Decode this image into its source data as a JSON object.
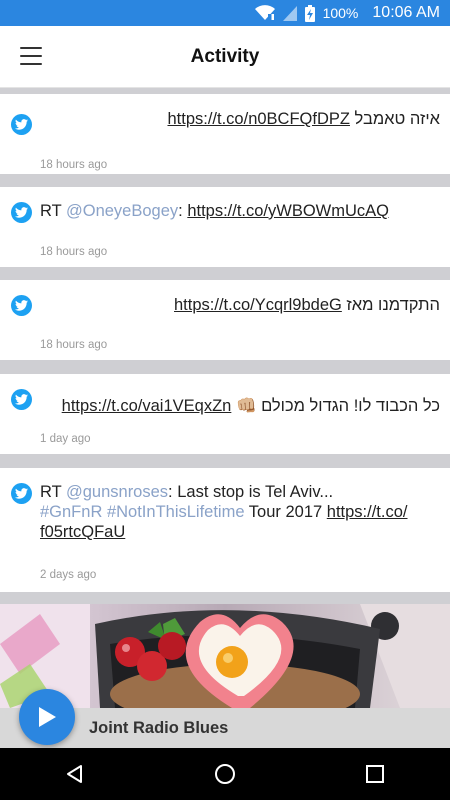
{
  "status": {
    "battery": "100%",
    "time": "10:06 AM",
    "icons": [
      "wifi-icon",
      "signal-icon",
      "battery-charging-icon"
    ]
  },
  "header": {
    "title": "Activity",
    "menu_icon": "hamburger-menu-icon"
  },
  "tweets": [
    {
      "text_prefix": "איזה טאמבל ",
      "link": "https://t.co/n0BCFQfDPZ",
      "time": "18 hours ago"
    },
    {
      "rt": "RT ",
      "mention": "@OneyeBogey",
      "sep": ": ",
      "link": "https://t.co/yWBOWmUcAQ",
      "time": "18 hours ago"
    },
    {
      "text_prefix": "התקדמנו מאז ",
      "link": "https://t.co/Ycqrl9bdeG",
      "time": "18 hours ago"
    },
    {
      "text_prefix": "כל הכבוד לו! הגדול מכולם ",
      "emoji": "👊🏼",
      "link": "https://t.co/vai1VEqxZn",
      "time": "1 day ago"
    },
    {
      "rt": "RT ",
      "mention": "@gunsnroses",
      "text1": ": Last stop is Tel Aviv...",
      "hashtag1": "#GnFnR",
      "hashtag2": "#NotInThisLifetime",
      "text2": " Tour 2017 ",
      "link_line1": "https://t.co/",
      "link_line2": "f05rtcQFaU",
      "time": "2 days ago"
    }
  ],
  "player": {
    "song": "Joint Radio Blues",
    "play_icon": "play-icon"
  },
  "navbar": {
    "back_icon": "back-icon",
    "home_icon": "home-icon",
    "recents_icon": "recents-icon"
  },
  "colors": {
    "accent": "#2b86e0",
    "twitter": "#1da1f2",
    "mention": "#8aa2c8"
  }
}
